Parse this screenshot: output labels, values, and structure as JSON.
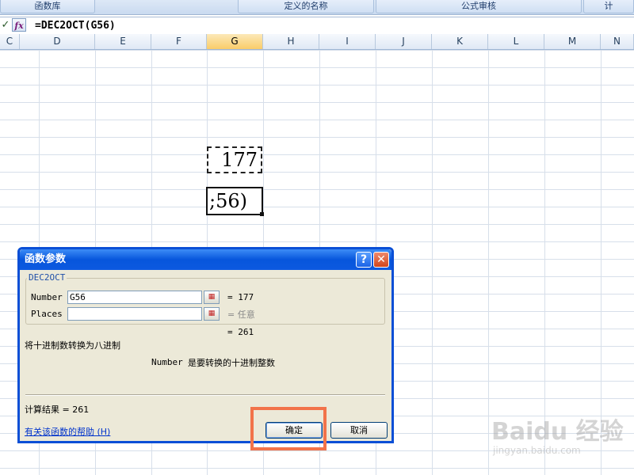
{
  "ribbon": {
    "groups": [
      "函数库",
      "定义的名称",
      "公式审核",
      "计"
    ]
  },
  "formula_bar": {
    "check_icon": "checkmark-icon",
    "fx_label": "fx",
    "formula": "=DEC2OCT(G56)"
  },
  "columns": [
    "C",
    "D",
    "E",
    "F",
    "G",
    "H",
    "I",
    "J",
    "K",
    "L",
    "M",
    "N"
  ],
  "active_column": "G",
  "cells": {
    "copied_value": "177",
    "editing_text": ";56)"
  },
  "dialog": {
    "title": "函数参数",
    "function_name": "DEC2OCT",
    "args": [
      {
        "label": "Number",
        "value": "G56",
        "result": "=  177"
      },
      {
        "label": "Places",
        "value": "",
        "result": "=  任意"
      }
    ],
    "formula_result_inline": "=  261",
    "function_description": "将十进制数转换为八进制",
    "arg_description_name": "Number",
    "arg_description": "是要转换的十进制整数",
    "result_label": "计算结果 =  261",
    "help_link": "有关该函数的帮助 (H)",
    "ok_label": "确定",
    "cancel_label": "取消"
  },
  "watermark": {
    "brand": "Baidu 经验",
    "url": "jingyan.baidu.com"
  }
}
